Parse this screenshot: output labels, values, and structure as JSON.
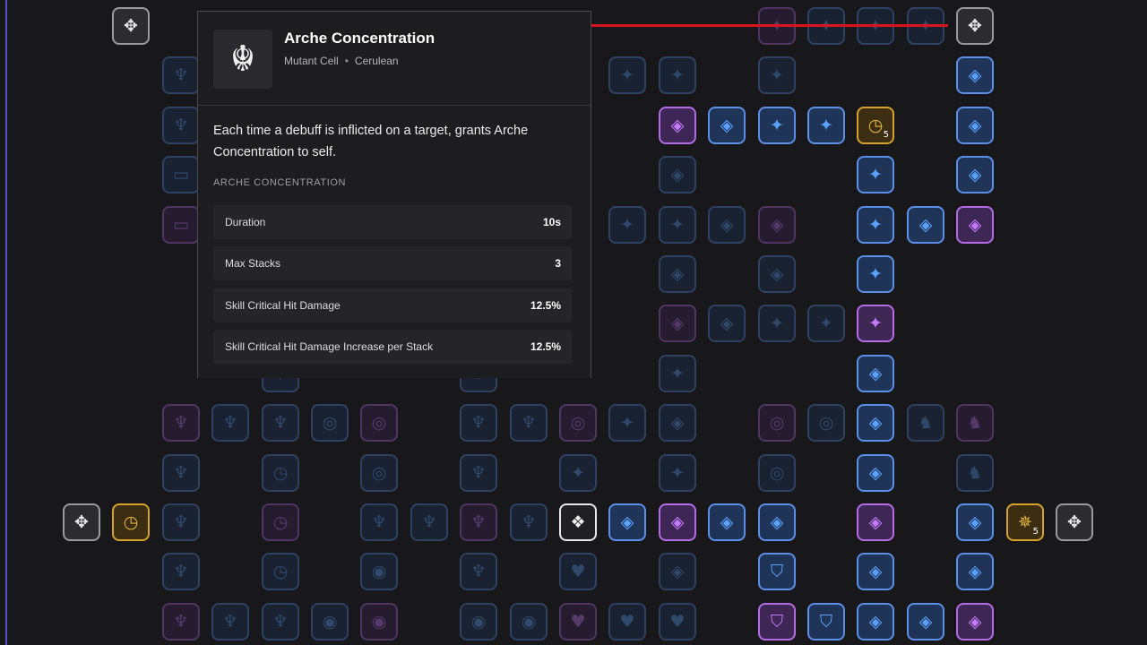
{
  "tooltip": {
    "title": "Arche Concentration",
    "type": "Mutant Cell",
    "rarity": "Cerulean",
    "description": "Each time a debuff is inflicted on a target, grants Arche Concentration to self.",
    "section_label": "ARCHE CONCENTRATION",
    "stats": [
      {
        "label": "Duration",
        "value": "10s"
      },
      {
        "label": "Max Stacks",
        "value": "3"
      },
      {
        "label": "Skill Critical Hit Damage",
        "value": "12.5%"
      },
      {
        "label": "Skill Critical Hit Damage Increase per Stack",
        "value": "12.5%"
      }
    ]
  },
  "colors": {
    "blue": "#5b8fe8",
    "purple": "#b46be6",
    "gold": "#d7a12b",
    "gray": "#9a9a9d",
    "white": "#e8e8e8",
    "highlight_line": "#d8141f"
  },
  "icons": {
    "arrows": "directional-arrows-icon",
    "spark": "spark-icon",
    "diamond": "diamond-icon",
    "claw": "claw-icon",
    "clock": "clock-icon",
    "target": "target-icon",
    "heart": "heart-icon",
    "shield": "shield-icon",
    "compass": "compass-icon",
    "card": "card-icon",
    "circle": "circle-icon",
    "core": "core-diamond-icon",
    "mask": "mask-icon"
  },
  "grid": [
    {
      "r": 0,
      "c": 2,
      "t": "gray",
      "i": "arrows",
      "d": false
    },
    {
      "r": 0,
      "c": 15,
      "t": "purple",
      "i": "spark",
      "d": true
    },
    {
      "r": 0,
      "c": 16,
      "t": "blue",
      "i": "spark",
      "d": true
    },
    {
      "r": 0,
      "c": 17,
      "t": "blue",
      "i": "spark",
      "d": true
    },
    {
      "r": 0,
      "c": 18,
      "t": "blue",
      "i": "spark",
      "d": true
    },
    {
      "r": 0,
      "c": 19,
      "t": "gray",
      "i": "arrows",
      "d": false
    },
    {
      "r": 1,
      "c": 3,
      "t": "blue",
      "i": "claw",
      "d": true
    },
    {
      "r": 1,
      "c": 12,
      "t": "blue",
      "i": "spark",
      "d": true
    },
    {
      "r": 1,
      "c": 13,
      "t": "blue",
      "i": "spark",
      "d": true
    },
    {
      "r": 1,
      "c": 15,
      "t": "blue",
      "i": "spark",
      "d": true
    },
    {
      "r": 1,
      "c": 19,
      "t": "blue",
      "i": "diamond",
      "d": false
    },
    {
      "r": 2,
      "c": 3,
      "t": "blue",
      "i": "claw",
      "d": true
    },
    {
      "r": 2,
      "c": 13,
      "t": "purple",
      "i": "diamond",
      "d": false
    },
    {
      "r": 2,
      "c": 14,
      "t": "blue",
      "i": "diamond",
      "d": false
    },
    {
      "r": 2,
      "c": 15,
      "t": "blue",
      "i": "spark",
      "d": false
    },
    {
      "r": 2,
      "c": 16,
      "t": "blue",
      "i": "spark",
      "d": false
    },
    {
      "r": 2,
      "c": 17,
      "t": "gold",
      "i": "clock",
      "d": false,
      "n": "5"
    },
    {
      "r": 2,
      "c": 19,
      "t": "blue",
      "i": "diamond",
      "d": false
    },
    {
      "r": 3,
      "c": 3,
      "t": "blue",
      "i": "card",
      "d": true
    },
    {
      "r": 3,
      "c": 13,
      "t": "blue",
      "i": "diamond",
      "d": true
    },
    {
      "r": 3,
      "c": 17,
      "t": "blue",
      "i": "spark",
      "d": false
    },
    {
      "r": 3,
      "c": 19,
      "t": "blue",
      "i": "diamond",
      "d": false
    },
    {
      "r": 4,
      "c": 3,
      "t": "purple",
      "i": "card",
      "d": true
    },
    {
      "r": 4,
      "c": 12,
      "t": "blue",
      "i": "spark",
      "d": true
    },
    {
      "r": 4,
      "c": 13,
      "t": "blue",
      "i": "spark",
      "d": true
    },
    {
      "r": 4,
      "c": 14,
      "t": "blue",
      "i": "diamond",
      "d": true
    },
    {
      "r": 4,
      "c": 15,
      "t": "purple",
      "i": "diamond",
      "d": true
    },
    {
      "r": 4,
      "c": 17,
      "t": "blue",
      "i": "spark",
      "d": false
    },
    {
      "r": 4,
      "c": 18,
      "t": "blue",
      "i": "diamond",
      "d": false
    },
    {
      "r": 4,
      "c": 19,
      "t": "purple",
      "i": "diamond",
      "d": false
    },
    {
      "r": 5,
      "c": 13,
      "t": "blue",
      "i": "diamond",
      "d": true
    },
    {
      "r": 5,
      "c": 15,
      "t": "blue",
      "i": "diamond",
      "d": true
    },
    {
      "r": 5,
      "c": 17,
      "t": "blue",
      "i": "spark",
      "d": false
    },
    {
      "r": 6,
      "c": 13,
      "t": "purple",
      "i": "diamond",
      "d": true
    },
    {
      "r": 6,
      "c": 14,
      "t": "blue",
      "i": "diamond",
      "d": true
    },
    {
      "r": 6,
      "c": 15,
      "t": "blue",
      "i": "spark",
      "d": true
    },
    {
      "r": 6,
      "c": 16,
      "t": "blue",
      "i": "spark",
      "d": true
    },
    {
      "r": 6,
      "c": 17,
      "t": "purple",
      "i": "spark",
      "d": false
    },
    {
      "r": 7,
      "c": 5,
      "t": "blue",
      "i": "claw",
      "d": true
    },
    {
      "r": 7,
      "c": 9,
      "t": "blue",
      "i": "claw",
      "d": true
    },
    {
      "r": 7,
      "c": 13,
      "t": "blue",
      "i": "spark",
      "d": true
    },
    {
      "r": 7,
      "c": 17,
      "t": "blue",
      "i": "diamond",
      "d": false
    },
    {
      "r": 8,
      "c": 3,
      "t": "purple",
      "i": "claw",
      "d": true
    },
    {
      "r": 8,
      "c": 4,
      "t": "blue",
      "i": "claw",
      "d": true
    },
    {
      "r": 8,
      "c": 5,
      "t": "blue",
      "i": "claw",
      "d": true
    },
    {
      "r": 8,
      "c": 6,
      "t": "blue",
      "i": "target",
      "d": true
    },
    {
      "r": 8,
      "c": 7,
      "t": "purple",
      "i": "target",
      "d": true
    },
    {
      "r": 8,
      "c": 9,
      "t": "blue",
      "i": "claw",
      "d": true
    },
    {
      "r": 8,
      "c": 10,
      "t": "blue",
      "i": "claw",
      "d": true
    },
    {
      "r": 8,
      "c": 11,
      "t": "purple",
      "i": "target",
      "d": true
    },
    {
      "r": 8,
      "c": 12,
      "t": "blue",
      "i": "spark",
      "d": true
    },
    {
      "r": 8,
      "c": 13,
      "t": "blue",
      "i": "diamond",
      "d": true
    },
    {
      "r": 8,
      "c": 15,
      "t": "purple",
      "i": "target",
      "d": true
    },
    {
      "r": 8,
      "c": 16,
      "t": "blue",
      "i": "target",
      "d": true
    },
    {
      "r": 8,
      "c": 17,
      "t": "blue",
      "i": "diamond",
      "d": false
    },
    {
      "r": 8,
      "c": 18,
      "t": "blue",
      "i": "mask",
      "d": true
    },
    {
      "r": 8,
      "c": 19,
      "t": "purple",
      "i": "mask",
      "d": true
    },
    {
      "r": 9,
      "c": 3,
      "t": "blue",
      "i": "claw",
      "d": true
    },
    {
      "r": 9,
      "c": 5,
      "t": "blue",
      "i": "clock",
      "d": true
    },
    {
      "r": 9,
      "c": 7,
      "t": "blue",
      "i": "target",
      "d": true
    },
    {
      "r": 9,
      "c": 9,
      "t": "blue",
      "i": "claw",
      "d": true
    },
    {
      "r": 9,
      "c": 11,
      "t": "blue",
      "i": "spark",
      "d": true
    },
    {
      "r": 9,
      "c": 13,
      "t": "blue",
      "i": "spark",
      "d": true
    },
    {
      "r": 9,
      "c": 15,
      "t": "blue",
      "i": "target",
      "d": true
    },
    {
      "r": 9,
      "c": 17,
      "t": "blue",
      "i": "diamond",
      "d": false
    },
    {
      "r": 9,
      "c": 19,
      "t": "blue",
      "i": "mask",
      "d": true
    },
    {
      "r": 10,
      "c": 1,
      "t": "gray",
      "i": "arrows",
      "d": false
    },
    {
      "r": 10,
      "c": 2,
      "t": "gold",
      "i": "clock",
      "d": false
    },
    {
      "r": 10,
      "c": 3,
      "t": "blue",
      "i": "claw",
      "d": true
    },
    {
      "r": 10,
      "c": 5,
      "t": "purple",
      "i": "clock",
      "d": true
    },
    {
      "r": 10,
      "c": 7,
      "t": "blue",
      "i": "claw",
      "d": true
    },
    {
      "r": 10,
      "c": 8,
      "t": "blue",
      "i": "claw",
      "d": true
    },
    {
      "r": 10,
      "c": 9,
      "t": "purple",
      "i": "claw",
      "d": true
    },
    {
      "r": 10,
      "c": 10,
      "t": "blue",
      "i": "claw",
      "d": true
    },
    {
      "r": 10,
      "c": 11,
      "t": "white",
      "i": "core",
      "d": false
    },
    {
      "r": 10,
      "c": 12,
      "t": "blue",
      "i": "diamond",
      "d": false
    },
    {
      "r": 10,
      "c": 13,
      "t": "purple",
      "i": "diamond",
      "d": false
    },
    {
      "r": 10,
      "c": 14,
      "t": "blue",
      "i": "diamond",
      "d": false
    },
    {
      "r": 10,
      "c": 15,
      "t": "blue",
      "i": "diamond",
      "d": false
    },
    {
      "r": 10,
      "c": 17,
      "t": "purple",
      "i": "diamond",
      "d": false
    },
    {
      "r": 10,
      "c": 19,
      "t": "blue",
      "i": "diamond",
      "d": false
    },
    {
      "r": 10,
      "c": 20,
      "t": "gold",
      "i": "compass",
      "d": false,
      "n": "5"
    },
    {
      "r": 10,
      "c": 21,
      "t": "gray",
      "i": "arrows",
      "d": false
    },
    {
      "r": 11,
      "c": 3,
      "t": "blue",
      "i": "claw",
      "d": true
    },
    {
      "r": 11,
      "c": 5,
      "t": "blue",
      "i": "clock",
      "d": true
    },
    {
      "r": 11,
      "c": 7,
      "t": "blue",
      "i": "circle",
      "d": true
    },
    {
      "r": 11,
      "c": 9,
      "t": "blue",
      "i": "claw",
      "d": true
    },
    {
      "r": 11,
      "c": 11,
      "t": "blue",
      "i": "heart",
      "d": true
    },
    {
      "r": 11,
      "c": 13,
      "t": "blue",
      "i": "diamond",
      "d": true
    },
    {
      "r": 11,
      "c": 15,
      "t": "blue",
      "i": "shield",
      "d": false
    },
    {
      "r": 11,
      "c": 17,
      "t": "blue",
      "i": "diamond",
      "d": false
    },
    {
      "r": 11,
      "c": 19,
      "t": "blue",
      "i": "diamond",
      "d": false
    },
    {
      "r": 12,
      "c": 3,
      "t": "purple",
      "i": "claw",
      "d": true
    },
    {
      "r": 12,
      "c": 4,
      "t": "blue",
      "i": "claw",
      "d": true
    },
    {
      "r": 12,
      "c": 5,
      "t": "blue",
      "i": "claw",
      "d": true
    },
    {
      "r": 12,
      "c": 6,
      "t": "blue",
      "i": "circle",
      "d": true
    },
    {
      "r": 12,
      "c": 7,
      "t": "purple",
      "i": "circle",
      "d": true
    },
    {
      "r": 12,
      "c": 9,
      "t": "blue",
      "i": "circle",
      "d": true
    },
    {
      "r": 12,
      "c": 10,
      "t": "blue",
      "i": "circle",
      "d": true
    },
    {
      "r": 12,
      "c": 11,
      "t": "purple",
      "i": "heart",
      "d": true
    },
    {
      "r": 12,
      "c": 12,
      "t": "blue",
      "i": "heart",
      "d": true
    },
    {
      "r": 12,
      "c": 13,
      "t": "blue",
      "i": "heart",
      "d": true
    },
    {
      "r": 12,
      "c": 15,
      "t": "purple",
      "i": "shield",
      "d": false
    },
    {
      "r": 12,
      "c": 16,
      "t": "blue",
      "i": "shield",
      "d": false
    },
    {
      "r": 12,
      "c": 17,
      "t": "blue",
      "i": "diamond",
      "d": false
    },
    {
      "r": 12,
      "c": 18,
      "t": "blue",
      "i": "diamond",
      "d": false
    },
    {
      "r": 12,
      "c": 19,
      "t": "purple",
      "i": "diamond",
      "d": false
    }
  ]
}
